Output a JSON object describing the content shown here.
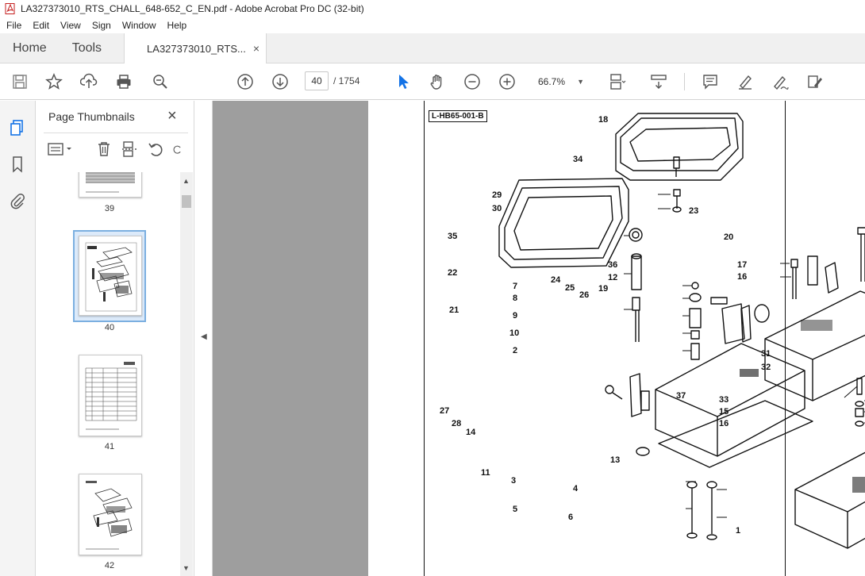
{
  "window": {
    "title": "LA327373010_RTS_CHALL_648-652_C_EN.pdf - Adobe Acrobat Pro DC (32-bit)"
  },
  "menu": [
    "File",
    "Edit",
    "View",
    "Sign",
    "Window",
    "Help"
  ],
  "tabs": {
    "home": "Home",
    "tools": "Tools",
    "document": "LA327373010_RTS...",
    "close": "×"
  },
  "toolbar": {
    "page_current": "40",
    "page_total": "/  1754",
    "zoom": "66.7%"
  },
  "panel": {
    "title": "Page Thumbnails",
    "close": "×",
    "thumbnails": [
      {
        "label": "39"
      },
      {
        "label": "40",
        "selected": true
      },
      {
        "label": "41"
      },
      {
        "label": "42"
      }
    ]
  },
  "document": {
    "figure_label": "L-HB65-001-B",
    "callouts": [
      "18",
      "34",
      "29",
      "30",
      "23",
      "35",
      "20",
      "22",
      "36",
      "12",
      "17",
      "16",
      "7",
      "24",
      "25",
      "19",
      "8",
      "26",
      "21",
      "9",
      "10",
      "2",
      "31",
      "32",
      "37",
      "33",
      "27",
      "15",
      "28",
      "14",
      "16",
      "13",
      "11",
      "3",
      "4",
      "5",
      "6",
      "1"
    ]
  },
  "colors": {
    "accent": "#1473e6",
    "selected_thumb": "#7bafe0",
    "doc_background": "#9e9e9e"
  }
}
